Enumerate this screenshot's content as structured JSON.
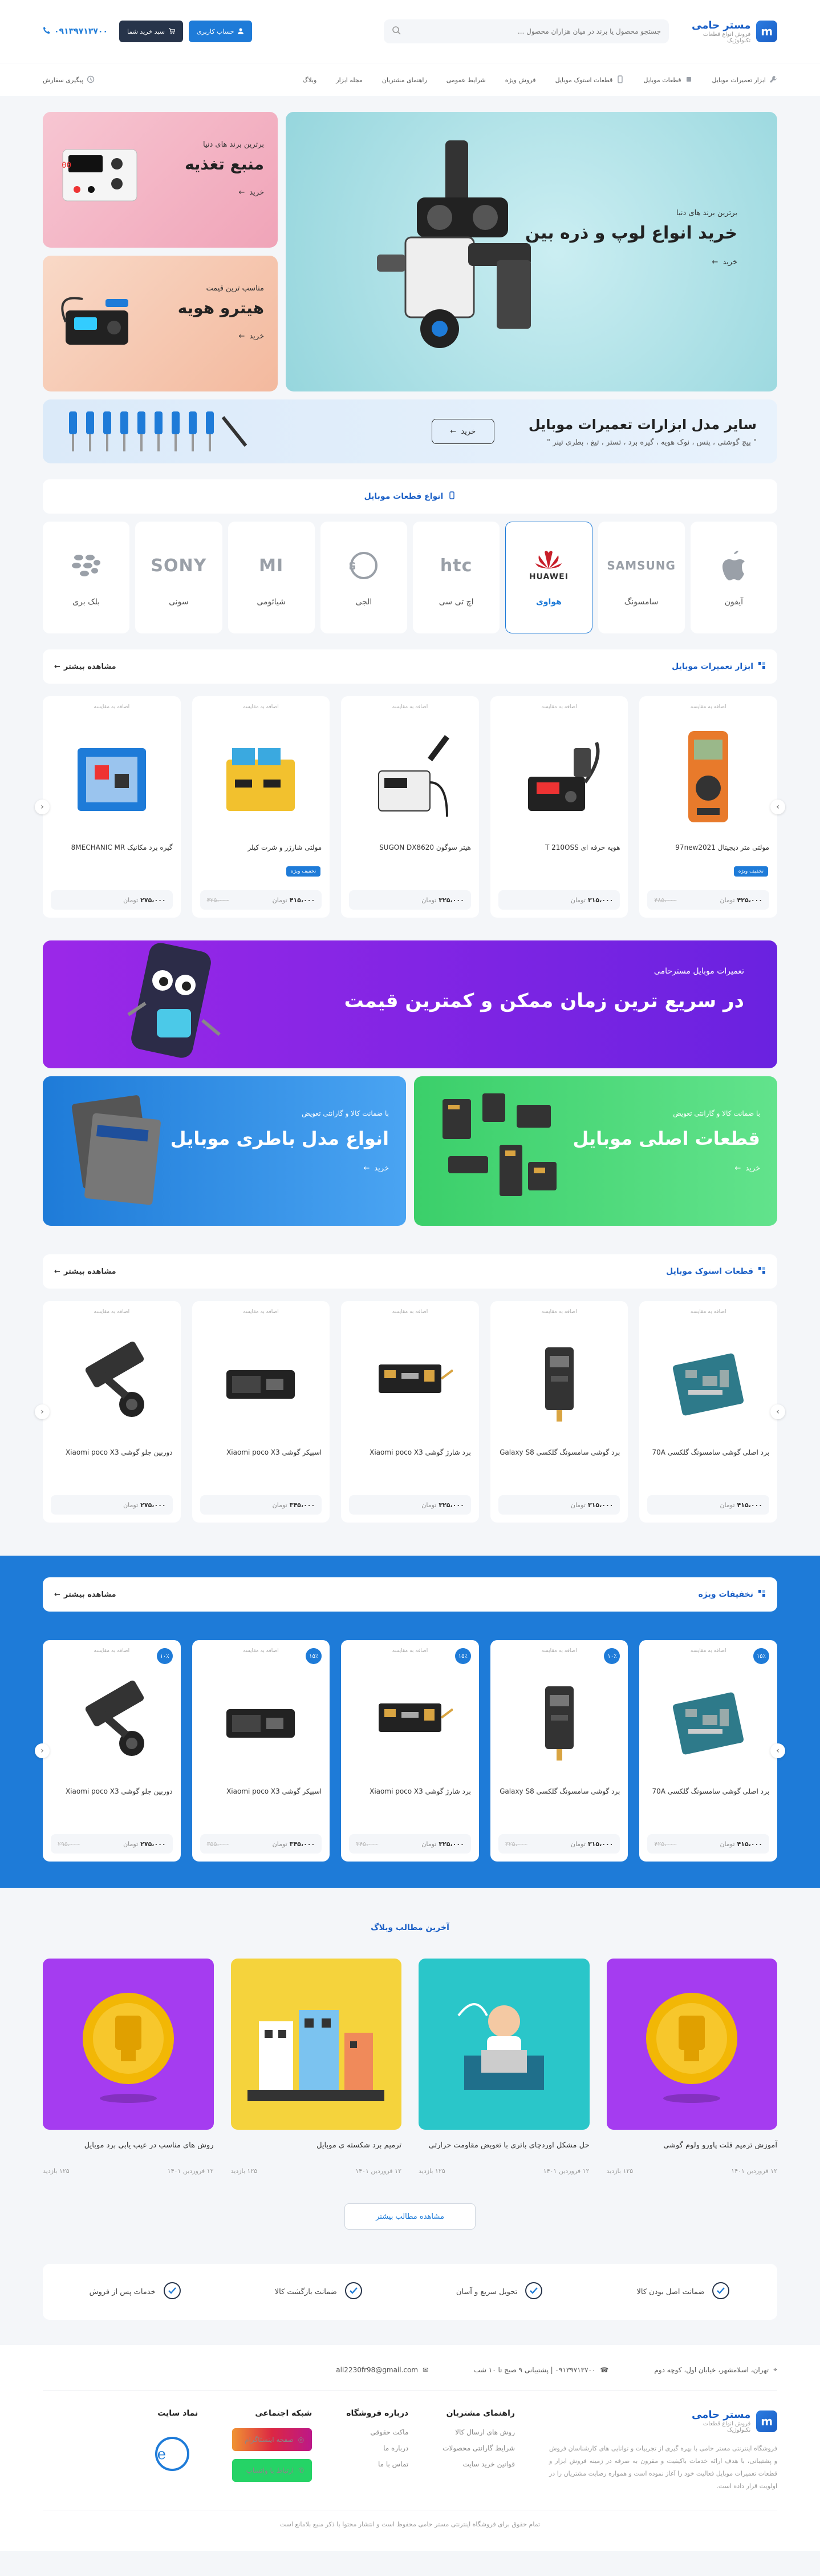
{
  "header": {
    "logo_mark": "m",
    "logo_title": "مستر حامی",
    "logo_sub": "فروش انواع قطعات تکنولوژیک",
    "search_placeholder": "جستجو محصول یا برند در میان هزاران محصول ...",
    "login_label": "حساب کاربری",
    "cart_label": "سبد خرید شما",
    "phone": "۰۹۱۳۹۷۱۳۷۰۰"
  },
  "nav": {
    "items": [
      "ابزار تعمیرات موبایل",
      "قطعات موبایل",
      "قطعات استوک موبایل",
      "فروش ویژه",
      "شرایط عمومی",
      "راهنمای مشتریان",
      "مجله ابزار",
      "وبلاگ"
    ],
    "track": "پیگیری سفارش"
  },
  "hero": {
    "main_sub": "برترین برند های دنیا",
    "main_title": "خرید انواع لوپ و ذره بین",
    "main_buy": "خرید",
    "side": [
      {
        "sub": "برترین برند های دنیا",
        "title": "منبع تغذیه",
        "buy": "خرید"
      },
      {
        "sub": "مناسب ترین قیمت",
        "title": "هیترو هویه",
        "buy": "خرید"
      }
    ]
  },
  "tools_banner": {
    "title": "سایر مدل ابزارات تعمیرات موبایل",
    "desc": "\" پیچ گوشتی ، پنس ، نوک هویه ، گیره برد ، تستر ، تیغ ، بطری تینر \"",
    "btn": "خرید"
  },
  "brands_section": {
    "title": "انواع قطعات موبایل",
    "brands": [
      {
        "logo": "",
        "name": "آیفون"
      },
      {
        "logo": "SAMSUNG",
        "name": "سامسونگ"
      },
      {
        "logo": "HUAWEI",
        "name": "هواوی"
      },
      {
        "logo": "htc",
        "name": "اچ تی سی"
      },
      {
        "logo": "LG",
        "name": "الجی"
      },
      {
        "logo": "MI",
        "name": "شیائومی"
      },
      {
        "logo": "SONY",
        "name": "سونی"
      },
      {
        "logo": "BB",
        "name": "بلک بری"
      }
    ]
  },
  "tools_section": {
    "title": "ابزار تعمیرات موبایل",
    "more": "مشاهده بیشتر",
    "compare": "اضافه به مقایسه",
    "badge": "تخفیف ویژه",
    "currency": "تومان",
    "products": [
      {
        "name": "مولتی متر دیجیتال 97new2021",
        "price": "۴۲۵،۰۰۰",
        "old": "۴۸۵،۰۰۰",
        "img": "multimeter-icon"
      },
      {
        "name": "هویه حرفه ای T 210OSS",
        "price": "۳۱۵،۰۰۰",
        "old": "",
        "img": "soldering-station-icon"
      },
      {
        "name": "هیتر سوگون SUGON DX8620",
        "price": "۳۲۵،۰۰۰",
        "old": "",
        "img": "heater-icon"
      },
      {
        "name": "مولتی شارژر و شرت کیلر",
        "price": "۴۱۵،۰۰۰",
        "old": "۴۲۵،۰۰۰",
        "img": "charger-icon"
      },
      {
        "name": "گیره برد مکانیک 8MECHANIC MR",
        "price": "۲۷۵،۰۰۰",
        "old": "",
        "img": "board-holder-icon"
      }
    ]
  },
  "promo_wide": {
    "sub": "تعمیرات موبایل مسترحامی",
    "title": "در سریع ترین زمان ممکن و کمترین قیمت"
  },
  "promo_pair": [
    {
      "sub": "با ضمانت کالا و گارانتی تعویض",
      "title": "قطعات اصلی موبایل",
      "buy": "خرید"
    },
    {
      "sub": "با ضمانت کالا و گارانتی تعویض",
      "title": "انواع مدل باطری موبایل",
      "buy": "خرید"
    }
  ],
  "stock_section": {
    "title": "قطعات استوک موبایل",
    "more": "مشاهده بیشتر",
    "products": [
      {
        "name": "برد اصلی گوشی سامسونگ گلکسی 70A",
        "price": "۴۱۵،۰۰۰",
        "old": "",
        "img": "mainboard-icon"
      },
      {
        "name": "برد گوشی سامسونگ گلکسی Galaxy S8",
        "price": "۳۱۵،۰۰۰",
        "old": "",
        "img": "board-flex-icon"
      },
      {
        "name": "برد شارژ گوشی Xiaomi poco X3",
        "price": "۳۲۵،۰۰۰",
        "old": "",
        "img": "charge-board-icon"
      },
      {
        "name": "اسپیکر گوشی Xiaomi poco X3",
        "price": "۳۴۵،۰۰۰",
        "old": "",
        "img": "speaker-icon"
      },
      {
        "name": "دوربین جلو گوشی Xiaomi poco X3",
        "price": "۲۷۵،۰۰۰",
        "old": "",
        "img": "camera-flex-icon"
      }
    ]
  },
  "special_section": {
    "title": "تخفیفات ویژه",
    "more": "مشاهده بیشتر",
    "products": [
      {
        "name": "برد اصلی گوشی سامسونگ گلکسی 70A",
        "price": "۴۱۵،۰۰۰",
        "old": "۴۲۵،۰۰۰",
        "pct": "۱۵٪",
        "img": "mainboard-icon"
      },
      {
        "name": "برد گوشی سامسونگ گلکسی Galaxy S8",
        "price": "۳۱۵،۰۰۰",
        "old": "۳۲۵،۰۰۰",
        "pct": "۱۰٪",
        "img": "board-flex-icon"
      },
      {
        "name": "برد شارژ گوشی Xiaomi poco X3",
        "price": "۳۲۵،۰۰۰",
        "old": "۳۴۵،۰۰۰",
        "pct": "۱۵٪",
        "img": "charge-board-icon"
      },
      {
        "name": "اسپیکر گوشی Xiaomi poco X3",
        "price": "۳۴۵،۰۰۰",
        "old": "۳۵۵،۰۰۰",
        "pct": "۱۵٪",
        "img": "speaker-icon"
      },
      {
        "name": "دوربین جلو گوشی Xiaomi poco X3",
        "price": "۲۷۵،۰۰۰",
        "old": "۲۹۵،۰۰۰",
        "pct": "۱۰٪",
        "img": "camera-flex-icon"
      }
    ]
  },
  "blog": {
    "title": "آخرین مطالب وبلاگ",
    "more": "مشاهده مطالب بیشتر",
    "posts": [
      {
        "title": "آموزش ترمیم فلت پاورو ولوم گوشی",
        "date": "۱۲ فروردین ۱۴۰۱",
        "views": "۱۲۵ بازدید",
        "bg": "#a53cf0"
      },
      {
        "title": "حل مشکل اوردچای باتری با تعویض مقاومت حرارتی",
        "date": "۱۲ فروردین ۱۴۰۱",
        "views": "۱۲۵ بازدید",
        "bg": "#2ac6c9"
      },
      {
        "title": "ترمیم برد شکسته ی موبایل",
        "date": "۱۲ فروردین ۱۴۰۱",
        "views": "۱۲۵ بازدید",
        "bg": "#f5d33c"
      },
      {
        "title": "روش های مناسب در عیب یابی برد موبایل",
        "date": "۱۲ فروردین ۱۴۰۱",
        "views": "۱۲۵ بازدید",
        "bg": "#a53cf0"
      }
    ]
  },
  "features": [
    "ضمانت اصل بودن کالا",
    "تحویل سریع و آسان",
    "ضمانت بازگشت کالا",
    "خدمات پس از فروش"
  ],
  "footer": {
    "address": "تهران، اسلامشهر، خیابان اول، کوچه دوم",
    "phone": "۰۹۱۳۹۷۱۳۷۰۰ | پشتیبانی ۹ صبح تا ۱۰ شب",
    "email": "ali2230fr98@gmail.com",
    "about": "فروشگاه اینترنتی مستر حامی با بهره گیری از تجربیات و توانایی های کارشناسان فروش و پشتیبانی، با هدف ارائه خدمات باکیفیت و مقرون به صرفه در زمینه فروش ابزار و قطعات تعمیرات موبایل فعالیت خود را آغاز نموده است و همواره رضایت مشتریان را در اولویت قرار داده است.",
    "col1_title": "راهنمای مشتریان",
    "col1": [
      "روش های ارسال کالا",
      "شرایط گارانتی محصولات",
      "قوانین خرید سایت"
    ],
    "col2_title": "درباره فروشگاه",
    "col2": [
      "ماکت حقوقی",
      "درباره ما",
      "تماس با ما"
    ],
    "social_title": "شبکه اجتماعی",
    "instagram": "صفحه اینستاگرام",
    "whatsapp": "ارتباط با واتساپ",
    "trust_title": "نماد سایت",
    "copyright": "تمام حقوق برای فروشگاه اینترنتی مستر حامی محفوظ است و انتشار محتوا با ذکر منبع بلامانع است"
  }
}
